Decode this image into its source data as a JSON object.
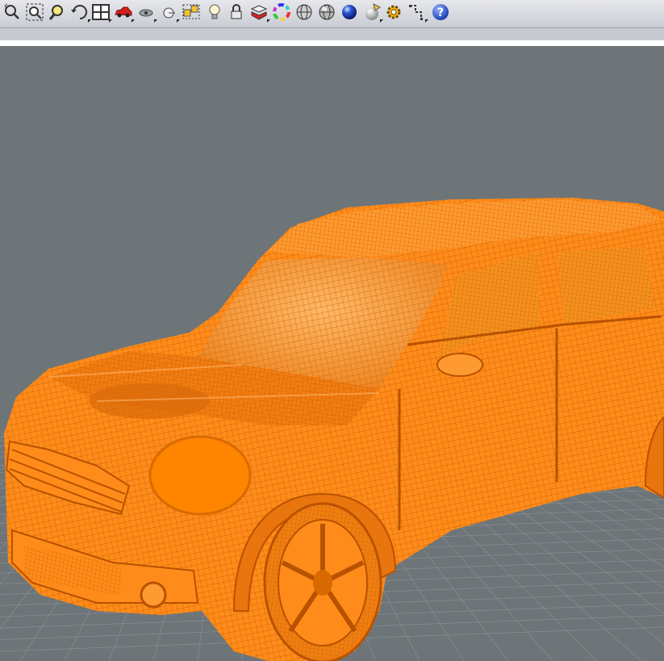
{
  "toolbar": {
    "tools": [
      {
        "name": "zoom-dynamic-icon",
        "tooltip": ""
      },
      {
        "name": "zoom-extents-icon",
        "tooltip": ""
      },
      {
        "name": "zoom-window-icon",
        "tooltip": ""
      },
      {
        "name": "undo-view-icon",
        "tooltip": ""
      },
      {
        "name": "viewport-layout-icon",
        "tooltip": ""
      },
      {
        "name": "car-object-icon",
        "tooltip": ""
      },
      {
        "name": "hide-object-icon",
        "tooltip": ""
      },
      {
        "name": "point-icon",
        "tooltip": ""
      },
      {
        "name": "select-group-icon",
        "tooltip": ""
      },
      {
        "name": "light-bulb-icon",
        "tooltip": ""
      },
      {
        "name": "lock-icon",
        "tooltip": ""
      },
      {
        "name": "material-layer-icon",
        "tooltip": ""
      },
      {
        "name": "color-wheel-icon",
        "tooltip": ""
      },
      {
        "name": "wireframe-sphere-icon",
        "tooltip": ""
      },
      {
        "name": "shaded-sphere-icon",
        "tooltip": ""
      },
      {
        "name": "rendered-sphere-icon",
        "tooltip": ""
      },
      {
        "name": "spotlight-icon",
        "tooltip": ""
      },
      {
        "name": "settings-gear-icon",
        "tooltip": ""
      },
      {
        "name": "transform-icon",
        "tooltip": ""
      },
      {
        "name": "help-icon",
        "tooltip": ""
      }
    ]
  },
  "viewport": {
    "view": "Perspective",
    "display_mode": "wireframe-shaded",
    "object_color": "#ff8c1a",
    "background_color": "#6e7578",
    "grid_color": "#8c9397"
  },
  "colors": {
    "toolbar_bg": "#d2d4da",
    "object_orange": "#ff8c1a",
    "wire_orange": "#c85e00",
    "viewport_bg": "#6e7578"
  }
}
